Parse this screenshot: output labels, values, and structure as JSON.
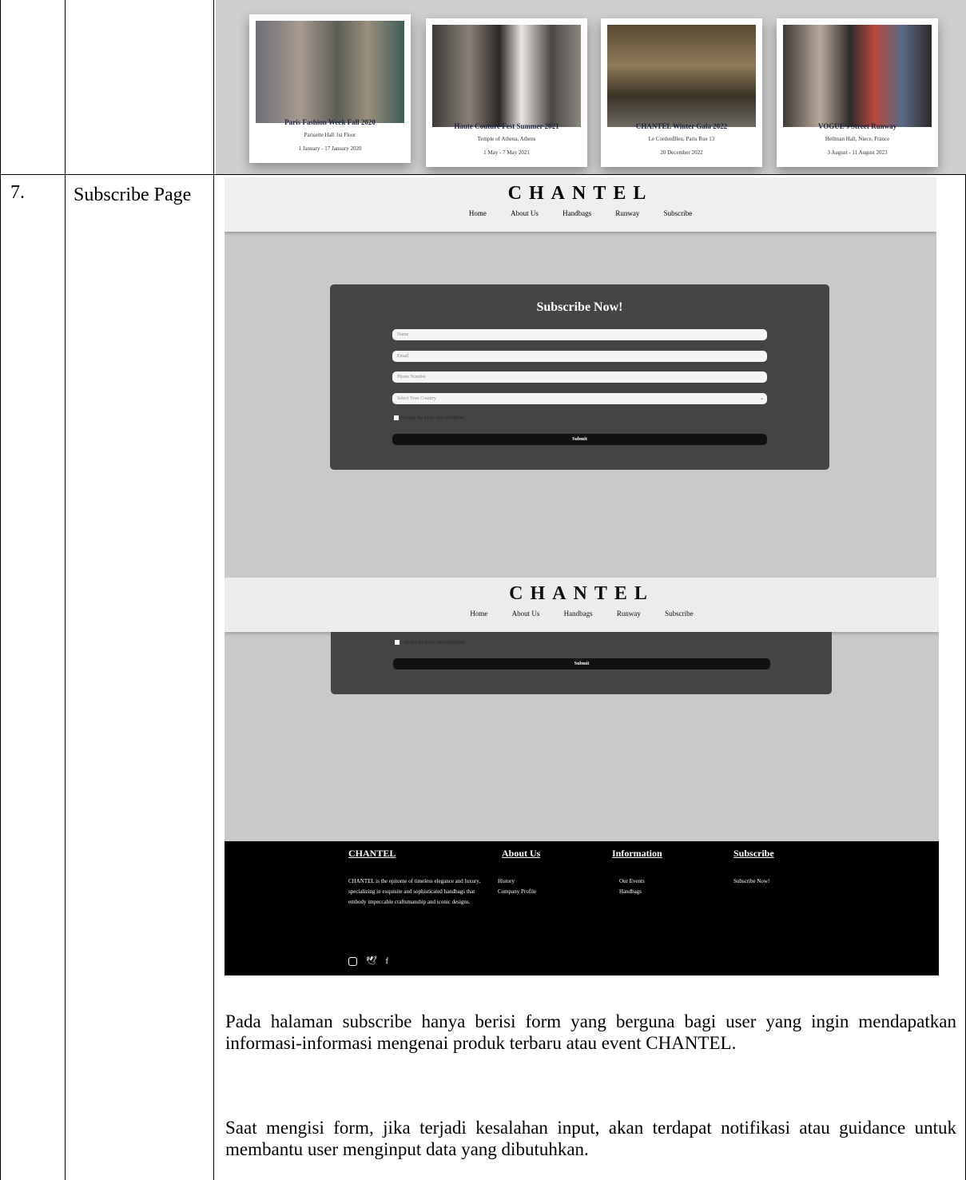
{
  "row_number": "7.",
  "row_title": "Subscribe Page",
  "gallery": {
    "cards": [
      {
        "title": "Paris Fashion Week Fall 2020",
        "location": "Parisette Hall 1st Floor",
        "dates": "1 January - 17 January 2020"
      },
      {
        "title": "Haute Couture Fest Summer 2021",
        "location": "Temple of Athena, Athens",
        "dates": "1 May - 7 May 2021"
      },
      {
        "title": "CHANTEL Winter Gala 2022",
        "location": "Le CordonBleu, Paris Rue 13",
        "dates": "20 December 2022"
      },
      {
        "title": "VOGUE's Street Runway",
        "location": "Hellman Hall, Niece, France",
        "dates": "3 August - 11 August 2023"
      }
    ]
  },
  "site": {
    "logo": "CHANTEL",
    "nav": [
      "Home",
      "About Us",
      "Handbags",
      "Runway",
      "Subscribe"
    ]
  },
  "form": {
    "title": "Subscribe Now!",
    "name_placeholder": "Name",
    "email_placeholder": "Email",
    "phone_placeholder": "Phone Number",
    "country_placeholder": "Select Your Country",
    "terms_label": "I accept the terms and conditions",
    "submit_label": "Submit"
  },
  "footer": {
    "col1_heading": "CHANTEL",
    "col1_text": "CHANTEL is the epitome of timeless elegance and luxury, specializing in exquisite and sophisticated handbags that embody impeccable craftsmanship and iconic designs.",
    "col2_heading": "About Us",
    "col2_items": [
      "History",
      "Company Profile"
    ],
    "col3_heading": "Information",
    "col3_items": [
      "Our Events",
      "Handbags"
    ],
    "col4_heading": "Subscribe",
    "col4_items": [
      "Subscribe Now!"
    ],
    "social_icons": [
      "instagram-icon",
      "twitter-icon",
      "facebook-icon"
    ]
  },
  "description": {
    "p1": "Pada halaman subscribe hanya berisi form yang berguna bagi user yang ingin mendapatkan informasi-informasi mengenai produk terbaru atau event CHANTEL.",
    "p2": "Saat mengisi form, jika terjadi kesalahan input, akan terdapat notifikasi atau guidance untuk membantu user menginput data yang dibutuhkan."
  }
}
